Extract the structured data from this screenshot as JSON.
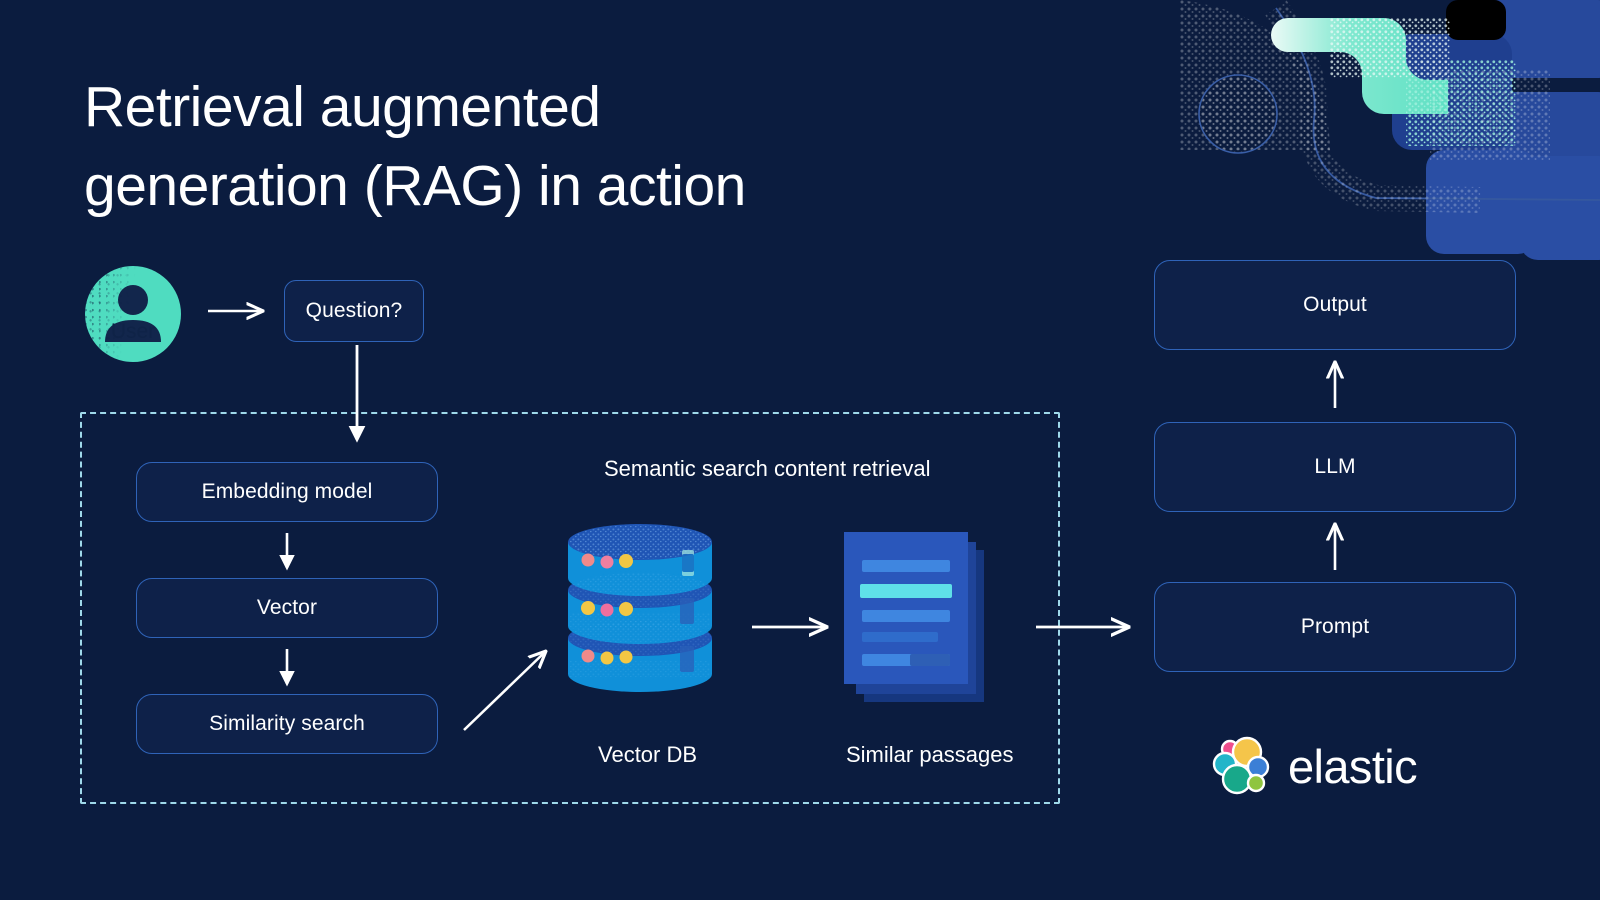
{
  "page": {
    "background_color": "#0b1c3f",
    "title": "Retrieval augmented\ngeneration (RAG) in action"
  },
  "colors": {
    "background": "#0b1c3f",
    "node_border": "#2f63b8",
    "node_fill": "#0e2149",
    "accent_teal": "#4fdcc0",
    "dashed_border": "#9fd9ea",
    "arrow": "#ffffff",
    "db_blue": "#1090d9",
    "db_top": "#1f55b5",
    "doc_front": "#2a57bb",
    "doc_back": "#1a3c8c",
    "deco_blue": "#27499c",
    "text": "#ffffff"
  },
  "user": {
    "label": "User",
    "icon": "person-icon"
  },
  "flow": {
    "question": {
      "label": "Question?"
    },
    "arrow_user_to_question": {
      "icon": "arrow-right-icon"
    },
    "arrow_question_to_embedding": {
      "icon": "arrow-down-icon"
    }
  },
  "retrieval_group": {
    "section_label": "Semantic search content retrieval",
    "left_column": [
      {
        "label": "Embedding model"
      },
      {
        "label": "Vector"
      },
      {
        "label": "Similarity search"
      }
    ],
    "column_arrows": [
      {
        "icon": "arrow-down-icon"
      },
      {
        "icon": "arrow-down-icon"
      }
    ],
    "arrow_similarity_to_db": {
      "icon": "arrow-up-right-icon"
    },
    "vector_db": {
      "label": "Vector DB",
      "icon": "database-cylinder-icon",
      "tiers": [
        {
          "dots": [
            "#f08a8a",
            "#ef7fa0",
            "#f2c744"
          ]
        },
        {
          "dots": [
            "#f2c744",
            "#ef6f9e",
            "#f2c744"
          ]
        },
        {
          "dots": [
            "#f08a8a",
            "#f2c744",
            "#f2c744"
          ]
        }
      ]
    },
    "arrow_db_to_passages": {
      "icon": "arrow-right-icon"
    },
    "similar_passages": {
      "label": "Similar passages",
      "icon": "documents-stack-icon",
      "line_count": 5,
      "highlighted_lines": [
        2,
        5
      ]
    },
    "arrow_passages_to_prompt": {
      "icon": "arrow-right-icon"
    }
  },
  "generation_column": {
    "boxes": [
      {
        "label": "Output"
      },
      {
        "label": "LLM"
      },
      {
        "label": "Prompt"
      }
    ],
    "arrows": [
      {
        "icon": "arrow-up-icon"
      },
      {
        "icon": "arrow-up-icon"
      }
    ]
  },
  "branding": {
    "wordmark": "elastic",
    "logo_icon": "elastic-cluster-logo",
    "logo_colors": [
      "#f5c54a",
      "#ef4e8c",
      "#22b5c9",
      "#18a88a",
      "#3b7fd6",
      "#8fc53f"
    ]
  },
  "decoration": {
    "icon": "abstract-particle-graphic",
    "shapes": [
      "teal-pill",
      "blue-rounded-rect",
      "circle-outline",
      "curved-path"
    ]
  }
}
